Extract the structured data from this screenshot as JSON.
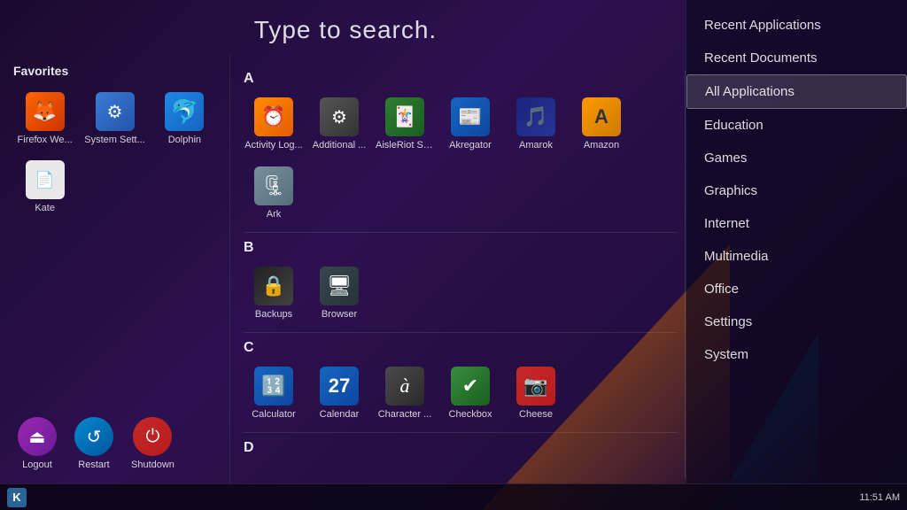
{
  "search": {
    "placeholder": "Type to search."
  },
  "favorites": {
    "title": "Favorites",
    "items": [
      {
        "id": "firefox",
        "label": "Firefox We...",
        "icon": "🦊",
        "iconClass": "icon-firefox"
      },
      {
        "id": "system-settings",
        "label": "System Sett...",
        "icon": "⚙",
        "iconClass": "icon-settings"
      },
      {
        "id": "dolphin",
        "label": "Dolphin",
        "icon": "🐬",
        "iconClass": "icon-dolphin"
      },
      {
        "id": "kate",
        "label": "Kate",
        "icon": "📄",
        "iconClass": "icon-kate"
      }
    ],
    "actions": [
      {
        "id": "logout",
        "label": "Logout",
        "iconClass": "icon-logout",
        "symbol": "⏏"
      },
      {
        "id": "restart",
        "label": "Restart",
        "iconClass": "icon-restart",
        "symbol": "↺"
      },
      {
        "id": "shutdown",
        "label": "Shutdown",
        "iconClass": "icon-shutdown",
        "symbol": "⏻"
      }
    ]
  },
  "sections": [
    {
      "letter": "A",
      "apps": [
        {
          "id": "activity-log",
          "label": "Activity Log...",
          "icon": "⏰",
          "iconClass": "icon-activity"
        },
        {
          "id": "additional",
          "label": "Additional ...",
          "icon": "⚙",
          "iconClass": "icon-additional"
        },
        {
          "id": "aisleriots",
          "label": "AisleRiot So...",
          "icon": "🃏",
          "iconClass": "icon-aisleriots"
        },
        {
          "id": "akregator",
          "label": "Akregator",
          "icon": "📰",
          "iconClass": "icon-akregator"
        },
        {
          "id": "amarok",
          "label": "Amarok",
          "icon": "🎵",
          "iconClass": "icon-amarok"
        },
        {
          "id": "amazon",
          "label": "Amazon",
          "icon": "A",
          "iconClass": "icon-amazon"
        },
        {
          "id": "ark",
          "label": "Ark",
          "icon": "🗜",
          "iconClass": "icon-ark"
        }
      ]
    },
    {
      "letter": "B",
      "apps": [
        {
          "id": "backups",
          "label": "Backups",
          "icon": "🔒",
          "iconClass": "icon-backups"
        },
        {
          "id": "browser",
          "label": "Browser",
          "icon": "🖥",
          "iconClass": "icon-browser"
        }
      ]
    },
    {
      "letter": "C",
      "apps": [
        {
          "id": "calculator",
          "label": "Calculator",
          "icon": "🔢",
          "iconClass": "icon-calculator"
        },
        {
          "id": "calendar",
          "label": "Calendar",
          "icon": "📅",
          "iconClass": "icon-calendar"
        },
        {
          "id": "character",
          "label": "Character ...",
          "icon": "à",
          "iconClass": "icon-character"
        },
        {
          "id": "checkbox",
          "label": "Checkbox",
          "icon": "✔",
          "iconClass": "icon-checkbox"
        },
        {
          "id": "cheese",
          "label": "Cheese",
          "icon": "📷",
          "iconClass": "icon-cheese"
        }
      ]
    },
    {
      "letter": "D",
      "apps": []
    }
  ],
  "right_panel": {
    "items": [
      {
        "id": "recent-applications",
        "label": "Recent Applications",
        "active": false
      },
      {
        "id": "recent-documents",
        "label": "Recent Documents",
        "active": false
      },
      {
        "id": "all-applications",
        "label": "All Applications",
        "active": true
      },
      {
        "id": "education",
        "label": "Education",
        "active": false
      },
      {
        "id": "games",
        "label": "Games",
        "active": false
      },
      {
        "id": "graphics",
        "label": "Graphics",
        "active": false
      },
      {
        "id": "internet",
        "label": "Internet",
        "active": false
      },
      {
        "id": "multimedia",
        "label": "Multimedia",
        "active": false
      },
      {
        "id": "office",
        "label": "Office",
        "active": false
      },
      {
        "id": "settings",
        "label": "Settings",
        "active": false
      },
      {
        "id": "system",
        "label": "System",
        "active": false
      }
    ]
  },
  "taskbar": {
    "time": "11:51 AM",
    "kde_label": "K"
  }
}
